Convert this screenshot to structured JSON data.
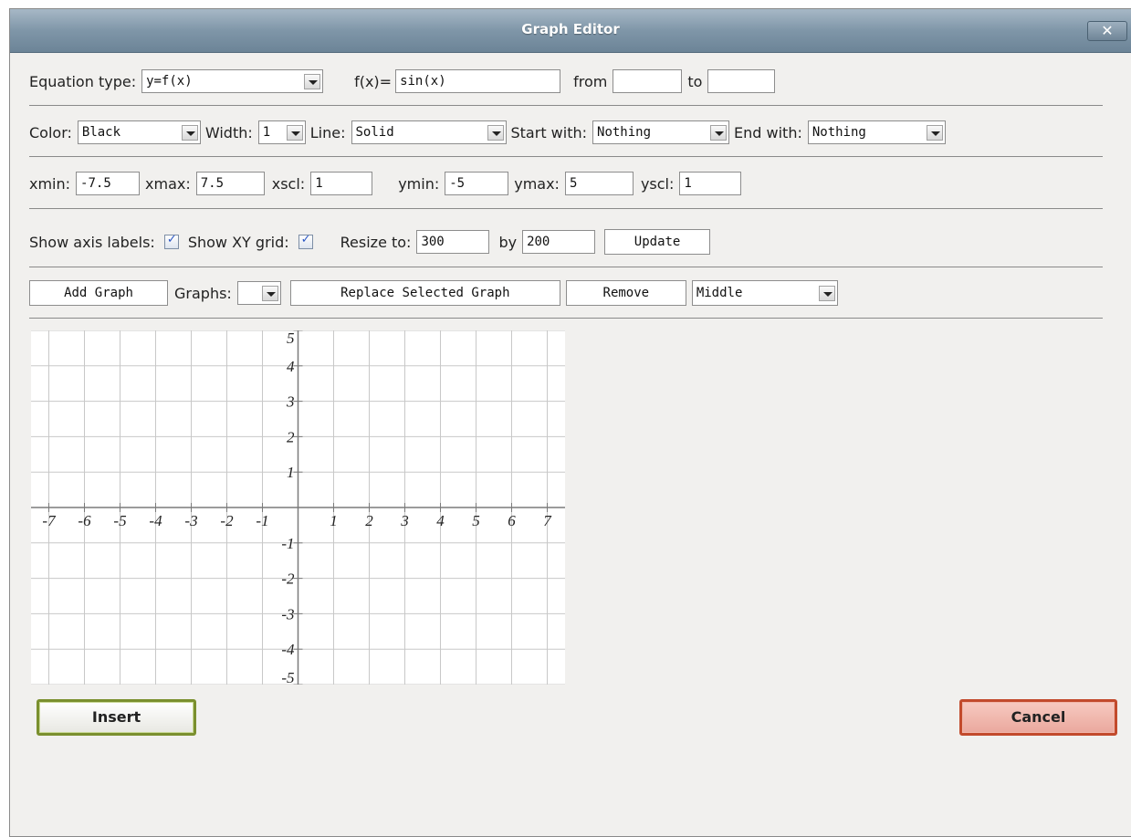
{
  "window": {
    "title": "Graph Editor",
    "close_glyph": "✕"
  },
  "row1": {
    "equation_type_label": "Equation type:",
    "equation_type_value": "y=f(x)",
    "fx_label": "f(x)=",
    "fx_value": "sin(x)",
    "from_label": "from",
    "from_value": "",
    "to_label": "to",
    "to_value": ""
  },
  "row2": {
    "color_label": "Color:",
    "color_value": "Black",
    "width_label": "Width:",
    "width_value": "1",
    "line_label": "Line:",
    "line_value": "Solid",
    "start_label": "Start with:",
    "start_value": "Nothing",
    "end_label": "End with:",
    "end_value": "Nothing"
  },
  "row3": {
    "xmin_label": "xmin:",
    "xmin_value": "-7.5",
    "xmax_label": "xmax:",
    "xmax_value": "7.5",
    "xscl_label": "xscl:",
    "xscl_value": "1",
    "ymin_label": "ymin:",
    "ymin_value": "-5",
    "ymax_label": "ymax:",
    "ymax_value": "5",
    "yscl_label": "yscl:",
    "yscl_value": "1"
  },
  "row4": {
    "show_axis_labels_label": "Show axis labels:",
    "show_axis_labels_checked": true,
    "show_xy_grid_label": "Show XY grid:",
    "show_xy_grid_checked": true,
    "resize_label": "Resize to:",
    "resize_width_value": "300",
    "by_label": "by",
    "resize_height_value": "200",
    "update_label": "Update"
  },
  "row5": {
    "add_graph_label": "Add Graph",
    "graphs_label": "Graphs:",
    "graphs_value": "",
    "replace_label": "Replace Selected Graph",
    "remove_label": "Remove",
    "position_value": "Middle"
  },
  "graph": {
    "xmin": -7.5,
    "xmax": 7.5,
    "ymin": -5,
    "ymax": 5,
    "x_tick_labels": [
      "-7",
      "-6",
      "-5",
      "-4",
      "-3",
      "-2",
      "-1",
      "1",
      "2",
      "3",
      "4",
      "5",
      "6",
      "7"
    ],
    "y_tick_labels": [
      "5",
      "4",
      "3",
      "2",
      "1",
      "-1",
      "-2",
      "-3",
      "-4",
      "-5"
    ],
    "grid": true,
    "grid_color": "#c8c8c8",
    "axis_color": "#7a7a7a"
  },
  "buttons": {
    "insert_label": "Insert",
    "cancel_label": "Cancel"
  },
  "colors": {
    "title_bar": "#7f96a8",
    "insert_border": "#7a8f2e",
    "cancel_border": "#c24a2c"
  }
}
